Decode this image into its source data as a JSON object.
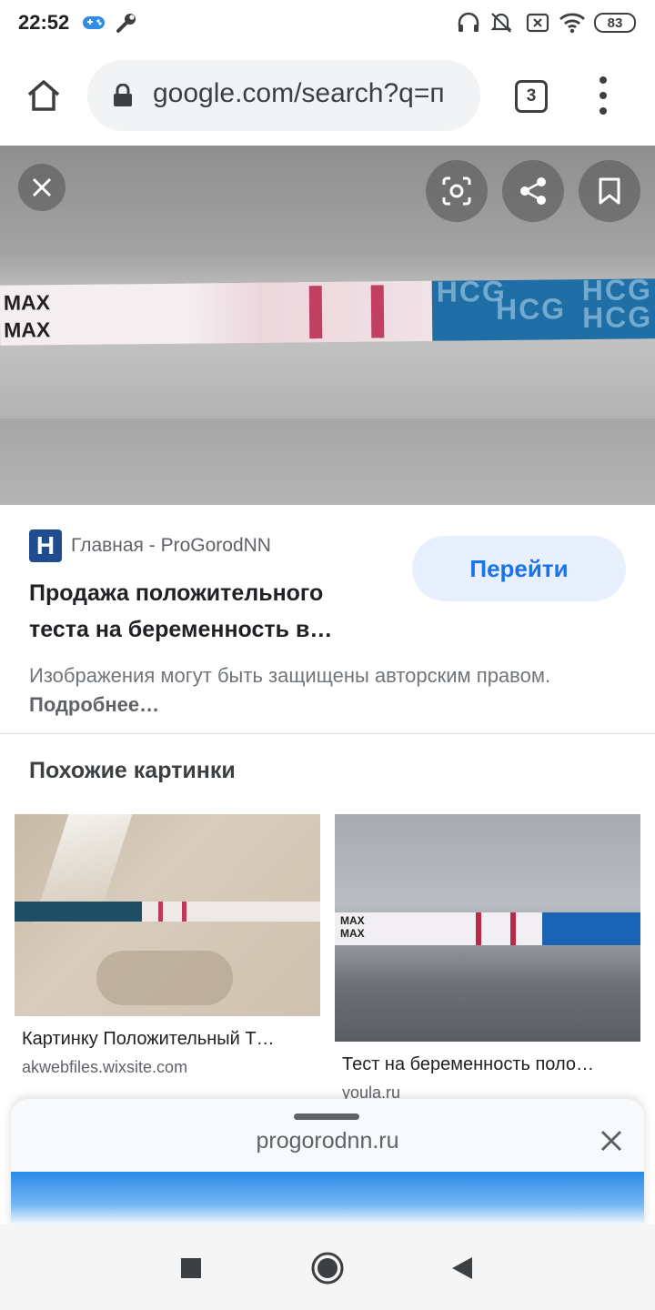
{
  "status": {
    "time": "22:52",
    "battery": "83",
    "icons": [
      "game-controller-icon",
      "wrench-icon",
      "headphones-icon",
      "bell-off-icon",
      "sim-off-icon",
      "wifi-icon",
      "battery-icon"
    ]
  },
  "toolbar": {
    "url": "google.com/search?q=п",
    "tab_count": "3",
    "icons": [
      "home-icon",
      "lock-icon",
      "more-vert-icon"
    ]
  },
  "hero": {
    "strip_labels": [
      "MAX",
      "MAX"
    ],
    "strip_brand": "HCG",
    "icons": [
      "close-icon",
      "lens-icon",
      "share-icon",
      "bookmark-icon"
    ]
  },
  "result": {
    "favicon_letter": "H",
    "source": "Главная - ProGorodNN",
    "title": "Продажа положительного теста на беременность в…",
    "go_label": "Перейти",
    "copyright_text": "Изображения могут быть защищены авторским правом.",
    "more_label": "Подробнее…"
  },
  "similar": {
    "heading": "Похожие картинки",
    "items": [
      {
        "caption": "Картинку Положительный Т…",
        "domain": "akwebfiles.wixsite.com"
      },
      {
        "caption": "Тест на беременность поло…",
        "domain": "youla.ru"
      }
    ]
  },
  "sheet": {
    "host": "progorodnn.ru"
  },
  "accent": "#1a73e8"
}
